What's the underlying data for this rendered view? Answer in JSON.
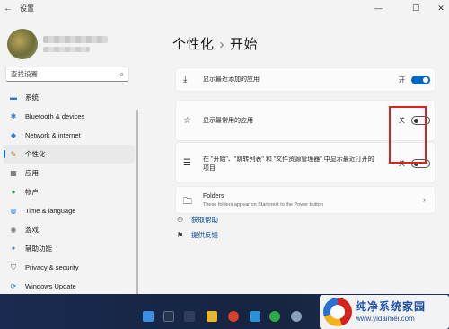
{
  "window": {
    "title": "设置",
    "back_glyph": "←",
    "minimize_glyph": "—",
    "maximize_glyph": "☐",
    "close_glyph": "✕"
  },
  "sidebar": {
    "search_placeholder": "查找设置",
    "search_icon": "⌕",
    "items": [
      {
        "label": "系统",
        "icon": "monitor-icon",
        "glyph": "▬",
        "color": "#2d7ad6"
      },
      {
        "label": "Bluetooth & devices",
        "icon": "bluetooth-icon",
        "glyph": "✱",
        "color": "#2d7ad6"
      },
      {
        "label": "Network & internet",
        "icon": "wifi-icon",
        "glyph": "◆",
        "color": "#2d7ad6"
      },
      {
        "label": "个性化",
        "icon": "pen-icon",
        "glyph": "✎",
        "color": "#c0702a"
      },
      {
        "label": "应用",
        "icon": "apps-icon",
        "glyph": "▦",
        "color": "#555555"
      },
      {
        "label": "帐户",
        "icon": "account-icon",
        "glyph": "●",
        "color": "#2a9d5c"
      },
      {
        "label": "Time & language",
        "icon": "globe-icon",
        "glyph": "◍",
        "color": "#2d7ad6"
      },
      {
        "label": "游戏",
        "icon": "gamepad-icon",
        "glyph": "◉",
        "color": "#777777"
      },
      {
        "label": "辅助功能",
        "icon": "accessibility-icon",
        "glyph": "✦",
        "color": "#2d7ad6"
      },
      {
        "label": "Privacy & security",
        "icon": "shield-icon",
        "glyph": "⛉",
        "color": "#666666"
      },
      {
        "label": "Windows Update",
        "icon": "update-icon",
        "glyph": "⟳",
        "color": "#2d7ad6"
      }
    ],
    "active_index": 3
  },
  "main": {
    "breadcrumb_parent": "个性化",
    "breadcrumb_sep": "›",
    "breadcrumb_current": "开始",
    "settings": [
      {
        "label": "显示最近添加的应用",
        "state_label": "开",
        "on": true,
        "icon": "download-icon",
        "glyph": "⤓"
      },
      {
        "label": "显示最常用的应用",
        "state_label": "关",
        "on": false,
        "icon": "star-icon",
        "glyph": "☆"
      },
      {
        "label": "在 \"开始\"、\"跳转列表\" 和 \"文件资源管理器\" 中显示最近打开的项目",
        "state_label": "关",
        "on": false,
        "icon": "list-icon",
        "glyph": "☰"
      }
    ],
    "folders": {
      "label": "Folders",
      "description": "These folders appear on Start next to the Power button",
      "icon": "folder-icon",
      "glyph": "🗀",
      "chevron": "›"
    },
    "links": [
      {
        "label": "获取帮助",
        "icon": "help-icon",
        "glyph": "⚇"
      },
      {
        "label": "提供反馈",
        "icon": "feedback-icon",
        "glyph": "⚑"
      }
    ]
  },
  "watermark": {
    "title": "纯净系统家园",
    "url": "www.yidaimei.com"
  },
  "colors": {
    "accent": "#0067c0",
    "highlight_box": "#e0201d"
  }
}
